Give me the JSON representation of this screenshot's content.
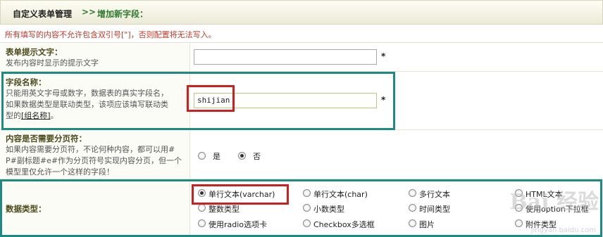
{
  "header": {
    "title": "自定义表单管理",
    "separator": ">>",
    "subtitle": "增加新字段："
  },
  "notice": "所有填写的内容不允许包含双引号[\"]，否则配置将无法写入。",
  "form_tip": {
    "title": "表单提示文字：",
    "desc": "发布内容时显示的提示文字",
    "value": "",
    "required": "*"
  },
  "field_name": {
    "title": "字段名称：",
    "desc_line1": "只能用英文字母或数字，数据表的真实字段名，",
    "desc_line2": "如果数据类型是联动类型，该项应该填写联动类",
    "desc_line3_pre": "型的",
    "desc_line3_link": "[组名称]",
    "desc_line3_post": "。",
    "value": "shijian",
    "required": "*"
  },
  "pagebreak": {
    "title": "内容是否需要分页符：",
    "desc_line1": "如果内容需要分页符，不论何种内容，都可以用#",
    "desc_line2": "P#副标题#e#作为分页符号实现内容分页，但一个",
    "desc_line3": "模型里仅允许一个这样的字段！",
    "opt_yes": "是",
    "opt_no": "否",
    "selected": "否"
  },
  "datatype": {
    "title": "数据类型：",
    "options": [
      "单行文本(varchar)",
      "单行文本(char)",
      "多行文本",
      "HTML文本",
      "整数类型",
      "小数类型",
      "时间类型",
      "使用option下拉框",
      "使用radio选项卡",
      "Checkbox多选框",
      "图片",
      "附件类型"
    ],
    "selected": "单行文本(varchar)"
  },
  "watermark": {
    "brand": "Bai 经验",
    "url": "jingyan.baidu.com"
  }
}
